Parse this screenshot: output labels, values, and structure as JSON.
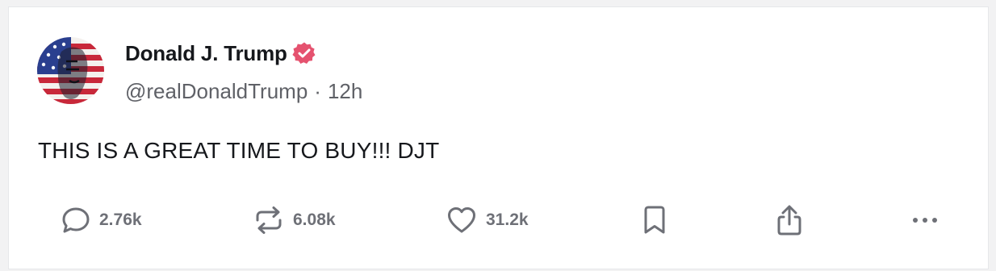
{
  "post": {
    "display_name": "Donald J. Trump",
    "handle": "@realDonaldTrump",
    "separator": "·",
    "time": "12h",
    "text": "THIS IS A GREAT TIME TO BUY!!! DJT",
    "verified_color": "#e5526f"
  },
  "actions": {
    "reply": {
      "icon": "reply-icon",
      "count": "2.76k"
    },
    "repost": {
      "icon": "repost-icon",
      "count": "6.08k"
    },
    "like": {
      "icon": "heart-icon",
      "count": "31.2k"
    },
    "bookmark": {
      "icon": "bookmark-icon"
    },
    "share": {
      "icon": "share-icon"
    },
    "more": {
      "icon": "more-icon"
    }
  }
}
